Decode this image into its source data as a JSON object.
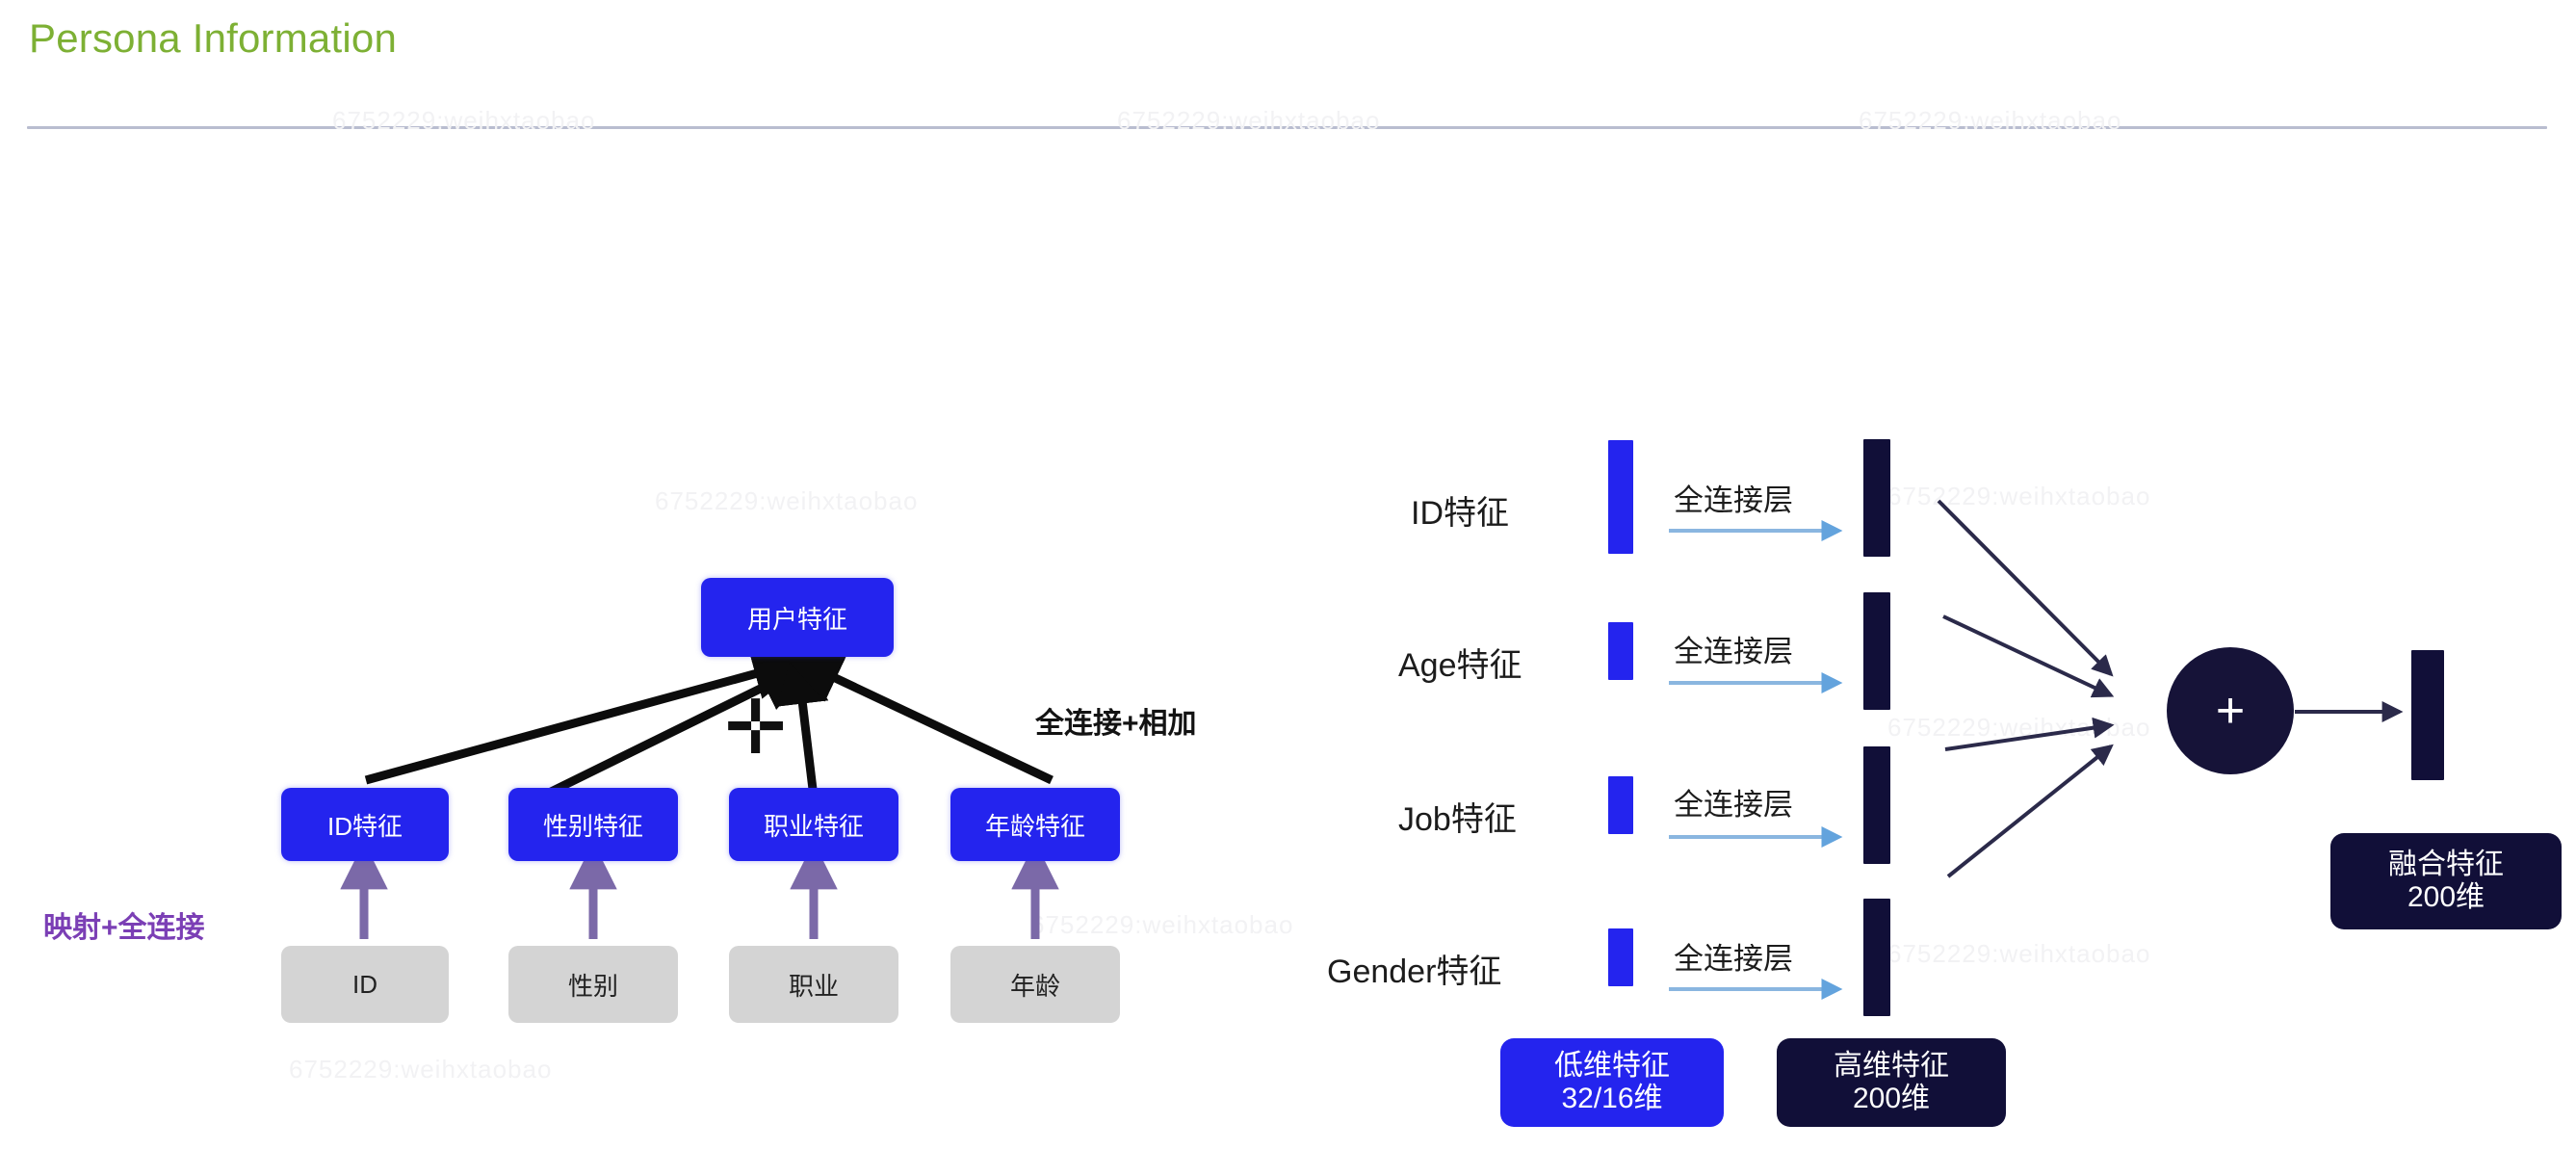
{
  "header": {
    "title": "Persona Information",
    "title_color": "#7db034",
    "divider_color": "#b9bdd0"
  },
  "watermark": {
    "text": "6752229:weihxtaobao"
  },
  "palette": {
    "blue": "#2424ee",
    "navy": "#110f38",
    "gray": "#d4d4d4",
    "light_blue_arrow": "#8ab6e0",
    "purple": "#7b3fb5",
    "black": "#111111"
  },
  "left_diagram": {
    "name": "user-feature-tree",
    "root": {
      "label": "用户特征"
    },
    "feature_nodes": [
      {
        "label": "ID特征"
      },
      {
        "label": "性别特征"
      },
      {
        "label": "职业特征"
      },
      {
        "label": "年龄特征"
      }
    ],
    "source_nodes": [
      {
        "label": "ID"
      },
      {
        "label": "性别"
      },
      {
        "label": "职业"
      },
      {
        "label": "年龄"
      }
    ],
    "annotations": {
      "mapping": "映射+全连接",
      "fusion": "全连接+相加",
      "plus_symbol": "✛"
    }
  },
  "right_diagram": {
    "name": "feature-fusion-network",
    "rows": [
      {
        "label": "ID特征",
        "op_label": "全连接层",
        "low_dim_bar_height": 118,
        "high_dim_bar_height": 110
      },
      {
        "label": "Age特征",
        "op_label": "全连接层",
        "low_dim_bar_height": 60,
        "high_dim_bar_height": 110
      },
      {
        "label": "Job特征",
        "op_label": "全连接层",
        "low_dim_bar_height": 60,
        "high_dim_bar_height": 110
      },
      {
        "label": "Gender特征",
        "op_label": "全连接层",
        "low_dim_bar_height": 60,
        "high_dim_bar_height": 110
      }
    ],
    "sum_symbol": "+",
    "legends": [
      {
        "name": "low-dim",
        "line1": "低维特征",
        "line2": "32/16维",
        "style": "blue"
      },
      {
        "name": "high-dim",
        "line1": "高维特征",
        "line2": "200维",
        "style": "navy"
      }
    ],
    "output": {
      "line1": "融合特征",
      "line2": "200维"
    }
  }
}
